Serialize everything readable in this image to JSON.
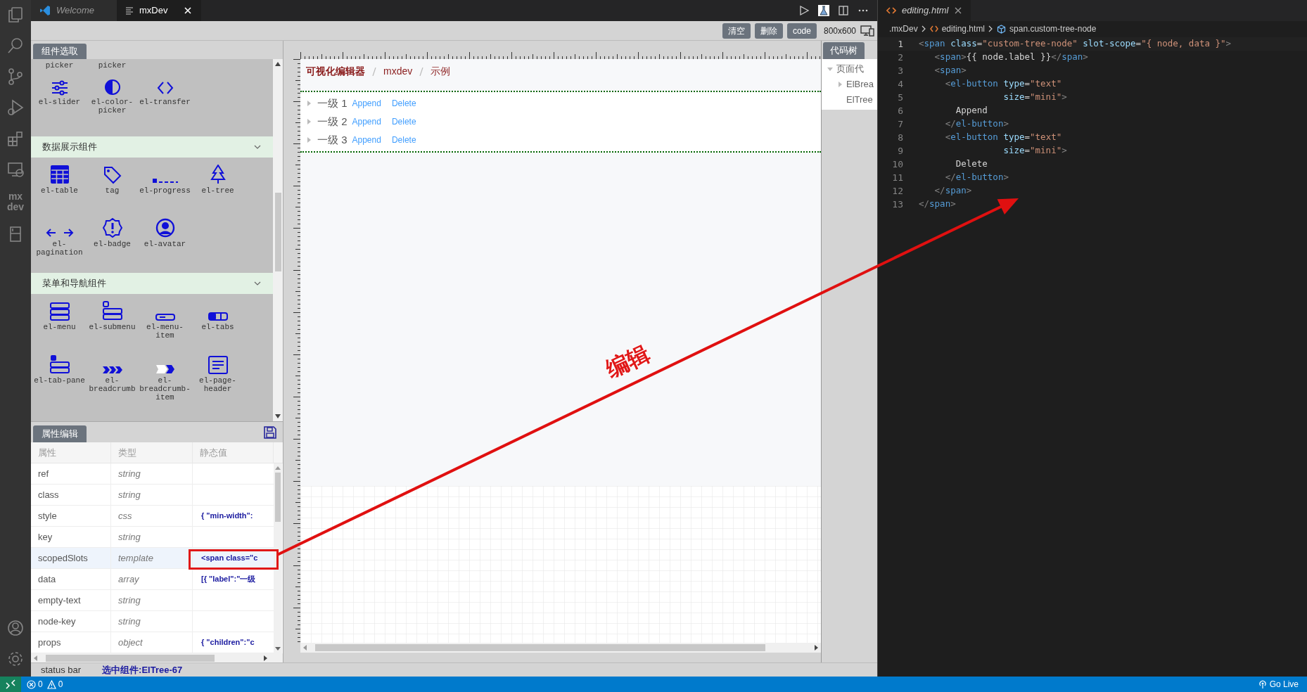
{
  "activity_bar": {
    "extension_label": "mx dev"
  },
  "editor_tabs": [
    {
      "label": "Welcome",
      "selected": false
    },
    {
      "label": "mxDev",
      "selected": true
    }
  ],
  "toolbar": {
    "buttons": [
      "清空",
      "删除",
      "code"
    ],
    "size": "800x600"
  },
  "palette": {
    "title": "组件选取",
    "groups": [
      {
        "rows": [
          [
            {
              "kind": "none",
              "label": "picker"
            },
            {
              "kind": "none",
              "label": "picker"
            }
          ],
          [
            {
              "kind": "slider",
              "label": "el-slider"
            },
            {
              "kind": "color-picker",
              "label": "el-color-picker"
            },
            {
              "kind": "transfer",
              "label": "el-transfer"
            }
          ]
        ]
      },
      {
        "title": "数据展示组件",
        "expanded": true,
        "rows": [
          [
            {
              "kind": "table",
              "label": "el-table"
            },
            {
              "kind": "tag",
              "label": "tag"
            },
            {
              "kind": "progress",
              "label": "el-progress"
            },
            {
              "kind": "tree",
              "label": "el-tree"
            }
          ],
          [
            {
              "kind": "pagination",
              "label": "el-pagination"
            },
            {
              "kind": "badge",
              "label": "el-badge"
            },
            {
              "kind": "avatar",
              "label": "el-avatar"
            }
          ]
        ]
      },
      {
        "title": "菜单和导航组件",
        "expanded": true,
        "rows": [
          [
            {
              "kind": "menu",
              "label": "el-menu"
            },
            {
              "kind": "submenu",
              "label": "el-submenu"
            },
            {
              "kind": "menu-item",
              "label": "el-menu-item"
            },
            {
              "kind": "tabs",
              "label": "el-tabs"
            }
          ],
          [
            {
              "kind": "tab-pane",
              "label": "el-tab-pane"
            },
            {
              "kind": "breadcrumb",
              "label": "el-breadcrumb"
            },
            {
              "kind": "breadcrumb-item",
              "label": "el-breadcrumb-item"
            },
            {
              "kind": "page-header",
              "label": "el-page-header"
            }
          ]
        ]
      }
    ]
  },
  "properties": {
    "title": "属性编辑",
    "columns": [
      "属性",
      "类型",
      "静态值"
    ],
    "rows": [
      {
        "name": "ref",
        "type": "string",
        "selected": false
      },
      {
        "name": "class",
        "type": "string",
        "selected": false
      },
      {
        "name": "style",
        "type": "css",
        "value": "{ \"min-width\":",
        "selected": false
      },
      {
        "name": "key",
        "type": "string",
        "selected": false
      },
      {
        "name": "scopedSlots",
        "type": "template",
        "value": "<span class=\"c",
        "selected": true
      },
      {
        "name": "data",
        "type": "array",
        "value": "[{ \"label\":\"一级",
        "selected": false
      },
      {
        "name": "empty-text",
        "type": "string",
        "selected": false
      },
      {
        "name": "node-key",
        "type": "string",
        "selected": false
      },
      {
        "name": "props",
        "type": "object",
        "value": "{ \"children\":\"c",
        "selected": false
      }
    ]
  },
  "canvas": {
    "breadcrumb": [
      "可视化编辑器",
      "mxdev",
      "示例"
    ],
    "tree": [
      {
        "label": "一级 1",
        "expanded": false,
        "actions": [
          "Append",
          "Delete"
        ]
      },
      {
        "label": "一级 2",
        "expanded": false,
        "actions": [
          "Append",
          "Delete"
        ]
      },
      {
        "label": "一级 3",
        "expanded": false,
        "actions": [
          "Append",
          "Delete"
        ]
      }
    ]
  },
  "code_tree": {
    "title": "代码树",
    "nodes": [
      {
        "label": "页面代",
        "expanded": true,
        "children": [
          {
            "label": "ElBrea",
            "expanded": false
          },
          {
            "label": "ElTree"
          }
        ]
      }
    ]
  },
  "app_status": {
    "label": "status bar",
    "selection": "选中组件:ElTree-67"
  },
  "code_editor": {
    "tab": "editing.html",
    "breadcrumb": [
      ".mxDev",
      "editing.html",
      "span.custom-tree-node"
    ],
    "lines": [
      {
        "number": "1",
        "current": true,
        "tokens": [
          {
            "kind": "punct",
            "text": "<"
          },
          {
            "kind": "tag",
            "text": "span"
          },
          {
            "kind": "attr",
            "text": " class"
          },
          {
            "kind": "text",
            "text": "="
          },
          {
            "kind": "str",
            "text": "\"custom-tree-node\""
          },
          {
            "kind": "attr",
            "text": " slot-scope"
          },
          {
            "kind": "text",
            "text": "="
          },
          {
            "kind": "str",
            "text": "\"{ node, data }\""
          },
          {
            "kind": "punct",
            "text": ">"
          }
        ]
      },
      {
        "number": "2",
        "current": false,
        "tokens": [
          {
            "kind": "punct",
            "text": "   <"
          },
          {
            "kind": "tag",
            "text": "span"
          },
          {
            "kind": "punct",
            "text": ">"
          },
          {
            "kind": "text",
            "text": "{{ node.label }}"
          },
          {
            "kind": "punct",
            "text": "</"
          },
          {
            "kind": "tag",
            "text": "span"
          },
          {
            "kind": "punct",
            "text": ">"
          }
        ]
      },
      {
        "number": "3",
        "current": false,
        "tokens": [
          {
            "kind": "punct",
            "text": "   <"
          },
          {
            "kind": "tag",
            "text": "span"
          },
          {
            "kind": "punct",
            "text": ">"
          }
        ]
      },
      {
        "number": "4",
        "current": false,
        "tokens": [
          {
            "kind": "punct",
            "text": "     <"
          },
          {
            "kind": "tag",
            "text": "el-button"
          },
          {
            "kind": "attr",
            "text": " type"
          },
          {
            "kind": "text",
            "text": "="
          },
          {
            "kind": "str",
            "text": "\"text\""
          }
        ]
      },
      {
        "number": "5",
        "current": false,
        "tokens": [
          {
            "kind": "attr",
            "text": "                size"
          },
          {
            "kind": "text",
            "text": "="
          },
          {
            "kind": "str",
            "text": "\"mini\""
          },
          {
            "kind": "punct",
            "text": ">"
          }
        ]
      },
      {
        "number": "6",
        "current": false,
        "tokens": [
          {
            "kind": "text",
            "text": "       Append"
          }
        ]
      },
      {
        "number": "7",
        "current": false,
        "tokens": [
          {
            "kind": "punct",
            "text": "     </"
          },
          {
            "kind": "tag",
            "text": "el-button"
          },
          {
            "kind": "punct",
            "text": ">"
          }
        ]
      },
      {
        "number": "8",
        "current": false,
        "tokens": [
          {
            "kind": "punct",
            "text": "     <"
          },
          {
            "kind": "tag",
            "text": "el-button"
          },
          {
            "kind": "attr",
            "text": " type"
          },
          {
            "kind": "text",
            "text": "="
          },
          {
            "kind": "str",
            "text": "\"text\""
          }
        ]
      },
      {
        "number": "9",
        "current": false,
        "tokens": [
          {
            "kind": "attr",
            "text": "                size"
          },
          {
            "kind": "text",
            "text": "="
          },
          {
            "kind": "str",
            "text": "\"mini\""
          },
          {
            "kind": "punct",
            "text": ">"
          }
        ]
      },
      {
        "number": "10",
        "current": false,
        "tokens": [
          {
            "kind": "text",
            "text": "       Delete"
          }
        ]
      },
      {
        "number": "11",
        "current": false,
        "tokens": [
          {
            "kind": "punct",
            "text": "     </"
          },
          {
            "kind": "tag",
            "text": "el-button"
          },
          {
            "kind": "punct",
            "text": ">"
          }
        ]
      },
      {
        "number": "12",
        "current": false,
        "tokens": [
          {
            "kind": "punct",
            "text": "   </"
          },
          {
            "kind": "tag",
            "text": "span"
          },
          {
            "kind": "punct",
            "text": ">"
          }
        ]
      },
      {
        "number": "13",
        "current": false,
        "tokens": [
          {
            "kind": "punct",
            "text": "</"
          },
          {
            "kind": "tag",
            "text": "span"
          },
          {
            "kind": "punct",
            "text": ">"
          }
        ]
      }
    ]
  },
  "status_bar": {
    "errors": "0",
    "warnings": "0",
    "go_live": "Go Live"
  },
  "annotation": {
    "label": "编辑"
  }
}
